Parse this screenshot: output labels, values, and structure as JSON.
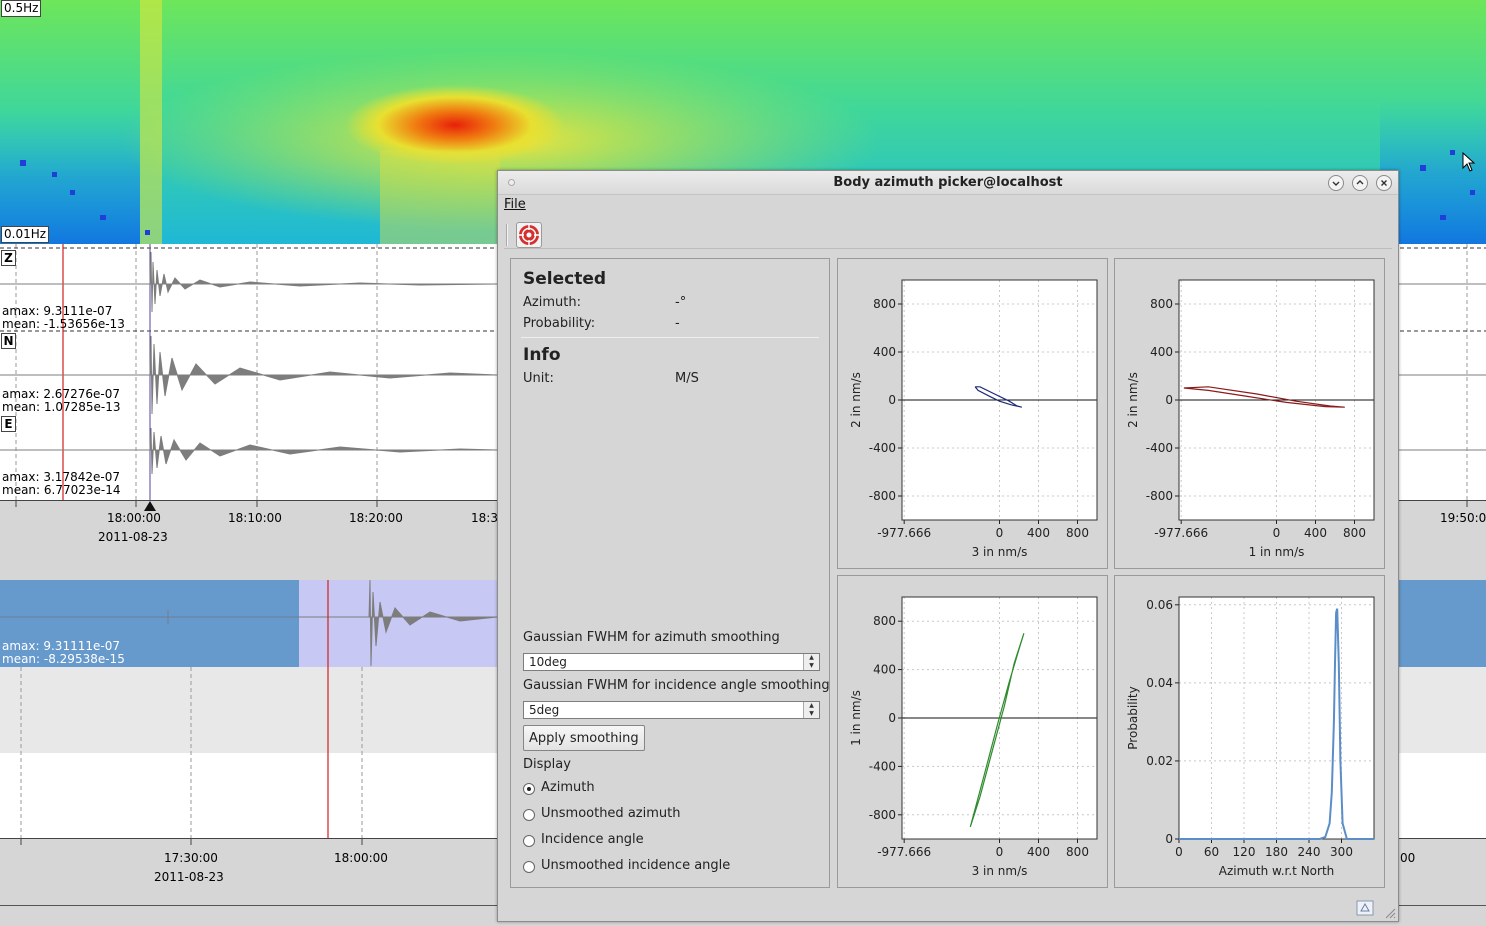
{
  "spectrogram": {
    "freq_top": "0.5Hz",
    "freq_bottom": "0.01Hz"
  },
  "traces": [
    {
      "component": "Z",
      "amax": "amax: 9.3111e-07",
      "mean": "mean: -1.53656e-13"
    },
    {
      "component": "N",
      "amax": "amax: 2.67276e-07",
      "mean": "mean: 1.07285e-13"
    },
    {
      "component": "E",
      "amax": "amax: 3.17842e-07",
      "mean": "mean: 6.77023e-14"
    }
  ],
  "time_axis": {
    "ticks": [
      "18:00:00",
      "18:10:00",
      "18:20:00",
      "18:3",
      "19:50:0"
    ],
    "date": "2011-08-23"
  },
  "overview": {
    "amax": "amax: 9.31111e-07",
    "mean": "mean: -8.29538e-15"
  },
  "bottom_axis": {
    "ticks": [
      "17:30:00",
      "18:00:00",
      "00"
    ],
    "date": "2011-08-23"
  },
  "dialog": {
    "title": "Body azimuth picker@localhost",
    "menu_file": "File",
    "toolbar_pick_icon": "target-icon",
    "selected": {
      "heading": "Selected",
      "azimuth_label": "Azimuth:",
      "azimuth_value": "-°",
      "probability_label": "Probability:",
      "probability_value": "-"
    },
    "info": {
      "heading": "Info",
      "unit_label": "Unit:",
      "unit_value": "M/S"
    },
    "smoothing": {
      "azimuth_label": "Gaussian FWHM for azimuth smoothing",
      "azimuth_value": "10deg",
      "incidence_label": "Gaussian FWHM for incidence angle smoothing",
      "incidence_value": "5deg",
      "apply_label": "Apply smoothing"
    },
    "display": {
      "label": "Display",
      "options": [
        "Azimuth",
        "Unsmoothed azimuth",
        "Incidence angle",
        "Unsmoothed incidence angle"
      ],
      "selected": "Azimuth"
    }
  },
  "chart_data": [
    {
      "type": "line",
      "title": "",
      "xlabel": "3 in nm/s",
      "ylabel": "2 in nm/s",
      "xticks": [
        "-977.666",
        "0",
        "400",
        "800"
      ],
      "yticks": [
        "800",
        "400",
        "0",
        "-400",
        "-800"
      ],
      "xlim": [
        -1000,
        1000
      ],
      "ylim": [
        -1000,
        1000
      ],
      "grid": true,
      "series": [
        {
          "color": "#1f2a78",
          "x": [
            -250,
            -200,
            -50,
            100,
            180,
            230,
            120,
            0,
            -100,
            -220,
            -250
          ],
          "y": [
            110,
            110,
            50,
            -10,
            -50,
            -60,
            -40,
            -10,
            30,
            80,
            110
          ]
        }
      ]
    },
    {
      "type": "line",
      "title": "",
      "xlabel": "1 in nm/s",
      "ylabel": "2 in nm/s",
      "xticks": [
        "-977.666",
        "0",
        "400",
        "800"
      ],
      "yticks": [
        "800",
        "400",
        "0",
        "-400",
        "-800"
      ],
      "xlim": [
        -1000,
        1000
      ],
      "ylim": [
        -1000,
        1000
      ],
      "grid": true,
      "series": [
        {
          "color": "#8b1a1a",
          "x": [
            -950,
            -700,
            -200,
            200,
            550,
            700,
            500,
            100,
            -300,
            -700,
            -950
          ],
          "y": [
            100,
            110,
            50,
            -10,
            -50,
            -60,
            -55,
            -20,
            30,
            80,
            100
          ]
        }
      ]
    },
    {
      "type": "line",
      "title": "",
      "xlabel": "3 in nm/s",
      "ylabel": "1 in nm/s",
      "xticks": [
        "-977.666",
        "0",
        "400",
        "800"
      ],
      "yticks": [
        "800",
        "400",
        "0",
        "-400",
        "-800"
      ],
      "xlim": [
        -1000,
        1000
      ],
      "ylim": [
        -1000,
        1000
      ],
      "grid": true,
      "series": [
        {
          "color": "#2e8b2e",
          "x": [
            -300,
            -200,
            -50,
            50,
            150,
            250,
            220,
            100,
            -20,
            -150,
            -300
          ],
          "y": [
            -900,
            -650,
            -200,
            100,
            450,
            700,
            620,
            300,
            -50,
            -450,
            -900
          ]
        }
      ]
    },
    {
      "type": "line",
      "title": "",
      "xlabel": "Azimuth w.r.t North",
      "ylabel": "Probability",
      "xticks": [
        "0",
        "60",
        "120",
        "180",
        "240",
        "300"
      ],
      "yticks": [
        "0.06",
        "0.04",
        "0.02",
        "0"
      ],
      "xlim": [
        0,
        360
      ],
      "ylim": [
        0,
        0.062
      ],
      "grid": true,
      "series": [
        {
          "color": "#5b8ec9",
          "x": [
            0,
            260,
            270,
            278,
            282,
            286,
            288,
            290,
            292,
            295,
            298,
            302,
            310,
            360
          ],
          "y": [
            0,
            0,
            0.0005,
            0.004,
            0.012,
            0.03,
            0.045,
            0.058,
            0.059,
            0.045,
            0.02,
            0.004,
            0,
            0
          ]
        }
      ]
    }
  ]
}
